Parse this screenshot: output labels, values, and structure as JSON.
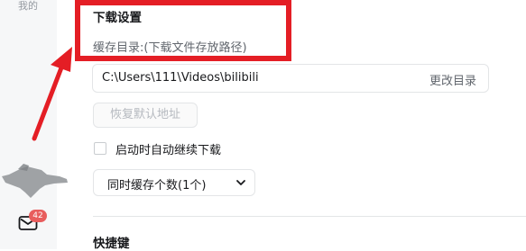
{
  "sidebar": {
    "mine_label": "我的",
    "messages_badge": "42"
  },
  "download_settings": {
    "section_title": "下载设置",
    "cache_dir_label": "缓存目录:(下载文件存放路径)",
    "cache_dir_value": "C:\\Users\\111\\Videos\\bilibili",
    "change_dir_button": "更改目录",
    "restore_default_button": "恢复默认地址",
    "auto_resume_label": "启动时自动继续下载",
    "auto_resume_checked": false,
    "concurrent_select_value": "同时缓存个数(1个)"
  },
  "shortcuts": {
    "section_title": "快捷键"
  },
  "colors": {
    "annotation": "#e41e25",
    "badge": "#e85d5d"
  }
}
